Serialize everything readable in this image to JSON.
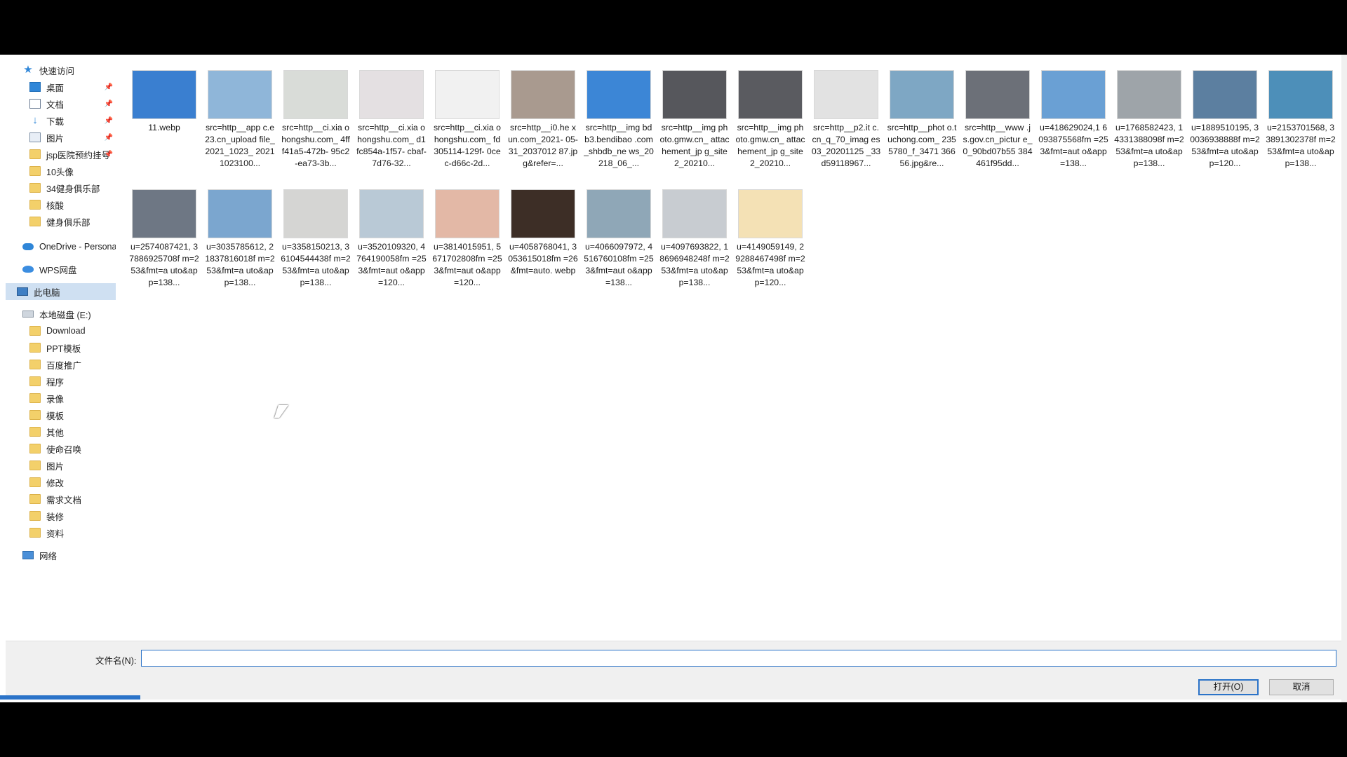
{
  "nav": {
    "items": [
      {
        "label": "快速访问",
        "icon": "star-icon",
        "pinned": false
      },
      {
        "label": "桌面",
        "icon": "desktop-icon",
        "pinned": true
      },
      {
        "label": "文档",
        "icon": "document-icon",
        "pinned": true
      },
      {
        "label": "下载",
        "icon": "download-icon",
        "pinned": true
      },
      {
        "label": "图片",
        "icon": "pictures-icon",
        "pinned": true
      },
      {
        "label": "jsp医院预约挂号",
        "icon": "folder-icon",
        "pinned": true
      },
      {
        "label": "10头像",
        "icon": "folder-icon",
        "pinned": false
      },
      {
        "label": "34健身俱乐部",
        "icon": "folder-icon",
        "pinned": false
      },
      {
        "label": "核酸",
        "icon": "folder-icon",
        "pinned": false
      },
      {
        "label": "健身俱乐部",
        "icon": "folder-icon",
        "pinned": false
      },
      {
        "label": "OneDrive - Personal",
        "icon": "cloud-icon",
        "pinned": false
      },
      {
        "label": "WPS网盘",
        "icon": "wps-cloud-icon",
        "pinned": false
      },
      {
        "label": "此电脑",
        "icon": "computer-icon",
        "pinned": false,
        "selected": true
      },
      {
        "label": "本地磁盘 (E:)",
        "icon": "drive-icon",
        "pinned": false
      },
      {
        "label": "Download",
        "icon": "folder-icon",
        "pinned": false
      },
      {
        "label": "PPT模板",
        "icon": "folder-icon",
        "pinned": false
      },
      {
        "label": "百度推广",
        "icon": "folder-icon",
        "pinned": false
      },
      {
        "label": "程序",
        "icon": "folder-icon",
        "pinned": false
      },
      {
        "label": "录像",
        "icon": "folder-icon",
        "pinned": false
      },
      {
        "label": "模板",
        "icon": "folder-icon",
        "pinned": false
      },
      {
        "label": "其他",
        "icon": "folder-icon",
        "pinned": false
      },
      {
        "label": "使命召唤",
        "icon": "folder-icon",
        "pinned": false
      },
      {
        "label": "图片",
        "icon": "folder-icon",
        "pinned": false
      },
      {
        "label": "修改",
        "icon": "folder-icon",
        "pinned": false
      },
      {
        "label": "需求文档",
        "icon": "folder-icon",
        "pinned": false
      },
      {
        "label": "装修",
        "icon": "folder-icon",
        "pinned": false
      },
      {
        "label": "资料",
        "icon": "folder-icon",
        "pinned": false
      },
      {
        "label": "网络",
        "icon": "network-icon",
        "pinned": false
      }
    ]
  },
  "files": [
    {
      "name": "11.webp",
      "color": "#3a7fd0"
    },
    {
      "name": "src=http__app c.e23.cn_upload file_2021_1023_ 20211023100...",
      "color": "#8fb6d9"
    },
    {
      "name": "src=http__ci.xia ohongshu.com_ 4fff41a5-472b- 95c2-ea73-3b...",
      "color": "#d9dcd8"
    },
    {
      "name": "src=http__ci.xia ohongshu.com_ d1fc854a-1f57- cbaf-7d76-32...",
      "color": "#e4e0e2"
    },
    {
      "name": "src=http__ci.xia ohongshu.com_ fd305114-129f- 0cec-d66c-2d...",
      "color": "#f1f1f1"
    },
    {
      "name": "src=http__i0.he xun.com_2021- 05-31_2037012 87.jpg&refer=...",
      "color": "#a99a8f"
    },
    {
      "name": "src=http__img bdb3.bendibao .com_shbdb_ne ws_20218_06_...",
      "color": "#3c86d6"
    },
    {
      "name": "src=http__img photo.gmw.cn_ attachement_jp g_site2_20210...",
      "color": "#56575c"
    },
    {
      "name": "src=http__img photo.gmw.cn_ attachement_jp g_site2_20210...",
      "color": "#5a5b60"
    },
    {
      "name": "src=http__p2.it c.cn_q_70_imag es03_20201125 _33d59118967...",
      "color": "#e2e2e2"
    },
    {
      "name": "src=http__phot o.tuchong.com_ 2355780_f_3471 36656.jpg&re...",
      "color": "#7ea7c4"
    },
    {
      "name": "src=http__www .js.gov.cn_pictur e_0_90bd07b55 384461f95dd...",
      "color": "#6c7078"
    },
    {
      "name": "u=418629024,1 6093875568fm =253&fmt=aut o&app=138...",
      "color": "#6aa0d4"
    },
    {
      "name": "u=1768582423, 14331388098f m=253&fmt=a uto&app=138...",
      "color": "#9ea4a9"
    },
    {
      "name": "u=1889510195, 30036938888f m=253&fmt=a uto&app=120...",
      "color": "#5c7fa0"
    },
    {
      "name": "u=2153701568, 33891302378f m=253&fmt=a uto&app=138...",
      "color": "#4d8fb9"
    },
    {
      "name": "u=2574087421, 37886925708f m=253&fmt=a uto&app=138...",
      "color": "#6e7784"
    },
    {
      "name": "u=3035785612, 21837816018f m=253&fmt=a uto&app=138...",
      "color": "#7ba6cf"
    },
    {
      "name": "u=3358150213, 36104544438f m=253&fmt=a uto&app=138...",
      "color": "#d5d5d3"
    },
    {
      "name": "u=3520109320, 4764190058fm =253&fmt=aut o&app=120...",
      "color": "#b9c9d6"
    },
    {
      "name": "u=3814015951, 5671702808fm =253&fmt=aut o&app=120...",
      "color": "#e3b8a6"
    },
    {
      "name": "u=4058768041, 3053615018fm =26&fmt=auto. webp",
      "color": "#3d2e26"
    },
    {
      "name": "u=4066097972, 4516760108fm =253&fmt=aut o&app=138...",
      "color": "#8fa7b7"
    },
    {
      "name": "u=4097693822, 18696948248f m=253&fmt=a uto&app=138...",
      "color": "#c8ccd1"
    },
    {
      "name": "u=4149059149, 29288467498f m=253&fmt=a uto&app=120...",
      "color": "#f4e1b5"
    }
  ],
  "footer": {
    "filename_label": "文件名(N):",
    "filename_value": "",
    "open_label": "打开(O)",
    "cancel_label": "取消"
  },
  "colors": {
    "accent": "#2b73c8",
    "selected_bg": "#cfe0f2",
    "folder": "#f3d06a"
  }
}
